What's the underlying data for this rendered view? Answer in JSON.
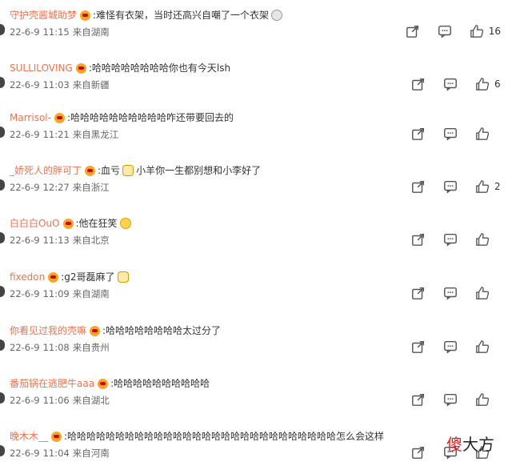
{
  "comments": [
    {
      "user": "守护壳酱城助梦",
      "text": ":难怪有衣架，当时还高兴自嘲了一个衣架",
      "emoji": "grin-face",
      "date": "22-6-9",
      "time": "11:15",
      "location": "来自湖南",
      "likes": "16"
    },
    {
      "user": "SULLILOVING",
      "text": ":哈哈哈哈哈哈哈哈你也有今天lsh",
      "emoji": "",
      "date": "22-6-9",
      "time": "11:03",
      "location": "来自新疆",
      "likes": "6"
    },
    {
      "user": "Marrisol-",
      "text": ":哈哈哈哈哈哈哈哈哈哈咋还带要回去的",
      "emoji": "",
      "date": "22-6-9",
      "time": "11:21",
      "location": "来自黑龙江",
      "likes": ""
    },
    {
      "user": "_娇死人的胖可丁",
      "text": ":血亏",
      "text2": "小羊你一生都别想和小李好了",
      "emoji": "cat-face",
      "date": "22-6-9",
      "time": "12:27",
      "location": "来自浙江",
      "likes": "2"
    },
    {
      "user": "白白白OuO",
      "text": ":他在狂笑",
      "emoji": "laughing-face",
      "date": "22-6-9",
      "time": "11:13",
      "location": "来自北京",
      "likes": ""
    },
    {
      "user": "fixedon",
      "text": ":g2哥磊麻了",
      "emoji": "panda-face",
      "date": "22-6-9",
      "time": "11:09",
      "location": "来自湖南",
      "likes": ""
    },
    {
      "user": "你看见过我的壳嘛",
      "text": ":哈哈哈哈哈哈哈哈太过分了",
      "emoji": "",
      "date": "22-6-9",
      "time": "11:08",
      "location": "来自贵州",
      "likes": ""
    },
    {
      "user": "番茄锅在逃肥牛aaa",
      "text": ":哈哈哈哈哈哈哈哈哈哈",
      "emoji": "",
      "date": "22-6-9",
      "time": "11:06",
      "location": "来自湖北",
      "likes": ""
    },
    {
      "user": "晚木木__",
      "text": ":哈哈哈哈哈哈哈哈哈哈哈哈哈哈哈哈哈哈哈哈哈哈哈哈哈哈哈哈怎么会这样",
      "emoji": "",
      "date": "22-6-9",
      "time": "11:04",
      "location": "来自河南",
      "likes": ""
    }
  ],
  "watermark": {
    "part1": "傻",
    "part2": "大方"
  },
  "icons": {
    "share": "share-icon",
    "comment": "comment-icon",
    "like": "thumbs-up-icon",
    "badge": "fan-badge-icon"
  },
  "colors": {
    "username": "#eb7350",
    "text": "#333333",
    "meta": "#666666",
    "watermark_red": "#e02020"
  }
}
